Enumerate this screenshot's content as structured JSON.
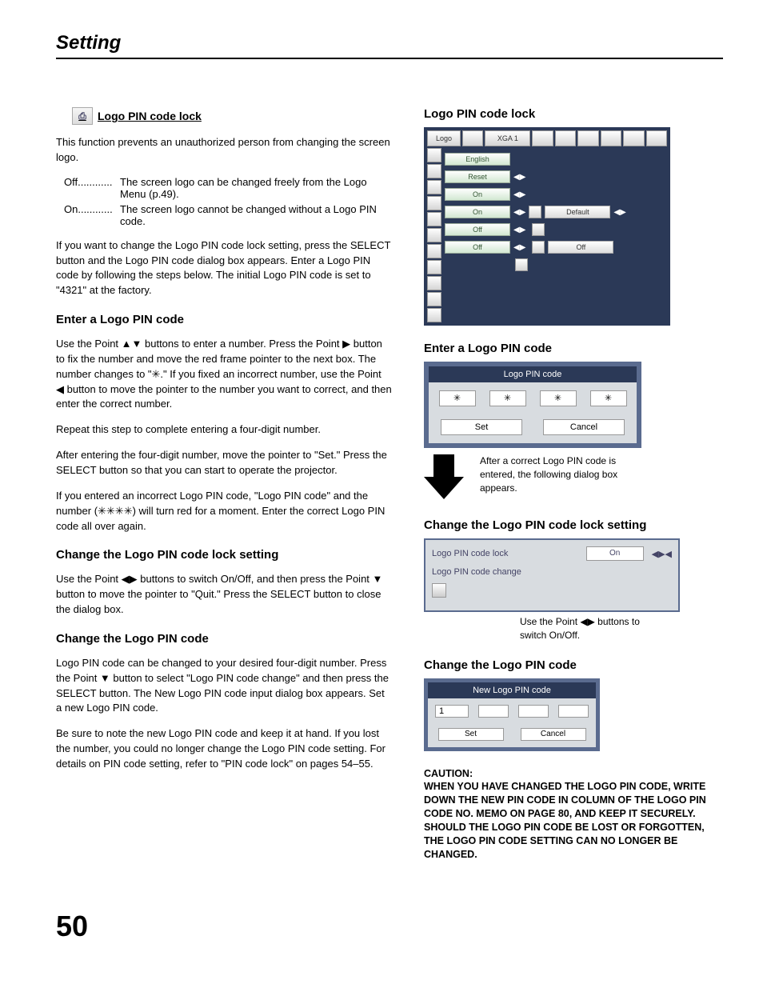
{
  "page": {
    "header": "Setting",
    "number": "50"
  },
  "left": {
    "section_title": "Logo PIN code lock",
    "intro": "This function prevents an unauthorized person from changing the screen logo.",
    "opts": {
      "off_label": "Off............",
      "off_desc": "The screen logo can be changed freely from the Logo Menu (p.49).",
      "on_label": "On............",
      "on_desc": "The screen logo cannot be changed without a Logo PIN code."
    },
    "para1": "If you want to change the Logo PIN code lock setting, press the SELECT button and the Logo PIN code dialog box appears. Enter a Logo PIN code by following the steps below. The initial Logo PIN code is set to \"4321\" at the factory.",
    "h_enter": "Enter a Logo PIN code",
    "enter_p1": "Use the Point ▲▼ buttons to enter a number. Press the Point ▶ button to fix the number and move the red frame pointer to the next box. The number changes to \"✳.\" If you fixed an incorrect number, use the Point ◀ button to move the pointer to the number you want to correct, and then enter the correct number.",
    "enter_p2": "Repeat this step to complete entering a four-digit number.",
    "enter_p3": "After entering the four-digit number, move the pointer to \"Set.\" Press the SELECT button so that you can start to operate the projector.",
    "enter_p4": "If you entered an incorrect Logo PIN code, \"Logo PIN code\" and the number (✳✳✳✳) will turn red for a moment. Enter the correct Logo PIN code all over again.",
    "h_change_lock": "Change the Logo PIN code lock setting",
    "change_lock_p": "Use the Point ◀▶ buttons to switch On/Off, and then press the Point ▼ button to move the pointer to \"Quit.\" Press the SELECT button to close the dialog box.",
    "h_change_code": "Change the Logo PIN code",
    "change_code_p1": "Logo PIN code can be changed to your desired four-digit number. Press the Point ▼ button to select \"Logo PIN code change\" and then press the SELECT button. The New Logo PIN code input dialog box appears. Set a new Logo PIN code.",
    "change_code_p2": "Be sure to note the new Logo PIN code and keep it at hand. If you lost the number, you could no longer change the Logo PIN code setting. For details on PIN code setting, refer to \"PIN code lock\" on pages 54–55."
  },
  "right": {
    "h_lock": "Logo PIN code lock",
    "menu": {
      "top_logo": "Logo",
      "top_xga": "XGA 1",
      "rows": {
        "english": "English",
        "reset": "Reset",
        "on1": "On",
        "on2": "On",
        "off1": "Off",
        "off2": "Off",
        "default": "Default",
        "off3": "Off"
      }
    },
    "h_enter": "Enter a Logo PIN code",
    "pin": {
      "title": "Logo PIN code",
      "star": "✳",
      "set": "Set",
      "cancel": "Cancel"
    },
    "arrow_caption": "After a correct Logo PIN code is entered, the following dialog box appears.",
    "h_change_lock": "Change the Logo PIN code lock setting",
    "lock_dialog": {
      "row1": "Logo PIN code lock",
      "row1_val": "On",
      "row1_arrows": "◀▶◀",
      "row2": "Logo PIN code change"
    },
    "lock_caption": "Use the Point ◀▶ buttons to switch On/Off.",
    "h_change_code": "Change the Logo PIN code",
    "new_pin": {
      "title": "New Logo PIN code",
      "val1": "1",
      "set": "Set",
      "cancel": "Cancel"
    },
    "caution_h": "CAUTION:",
    "caution_body": "WHEN YOU HAVE CHANGED THE LOGO PIN CODE, WRITE DOWN THE NEW PIN CODE IN COLUMN OF THE LOGO PIN CODE NO. MEMO ON PAGE 80, AND KEEP IT SECURELY. SHOULD THE LOGO PIN CODE BE LOST OR FORGOTTEN, THE LOGO PIN CODE SETTING CAN NO LONGER BE CHANGED."
  }
}
